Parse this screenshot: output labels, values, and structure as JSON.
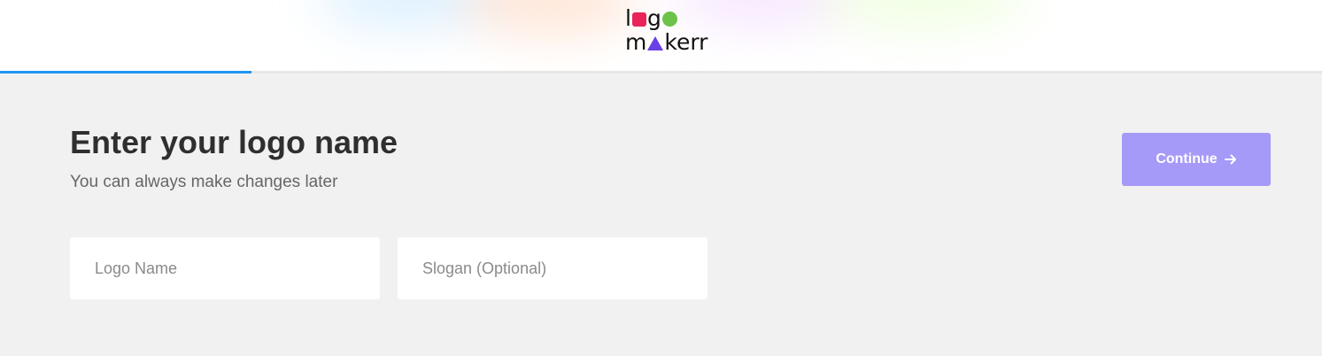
{
  "header": {
    "logo": {
      "line1_pre": "l",
      "line1_post": "g",
      "line2_pre": "m",
      "line2_post": "kerr",
      "accent_square": "#e8245b",
      "accent_circle": "#6dc24b",
      "accent_triangle": "#6a3fe6"
    },
    "progress": {
      "fraction": 0.19,
      "color": "#2196f3"
    }
  },
  "main": {
    "title": "Enter your logo name",
    "subtitle": "You can always make changes later",
    "continue_label": "Continue",
    "continue_icon": "arrow-right-icon",
    "continue_color": "#a59af7",
    "fields": {
      "logo_name": {
        "placeholder": "Logo Name",
        "value": ""
      },
      "slogan": {
        "placeholder": "Slogan (Optional)",
        "value": ""
      }
    }
  }
}
